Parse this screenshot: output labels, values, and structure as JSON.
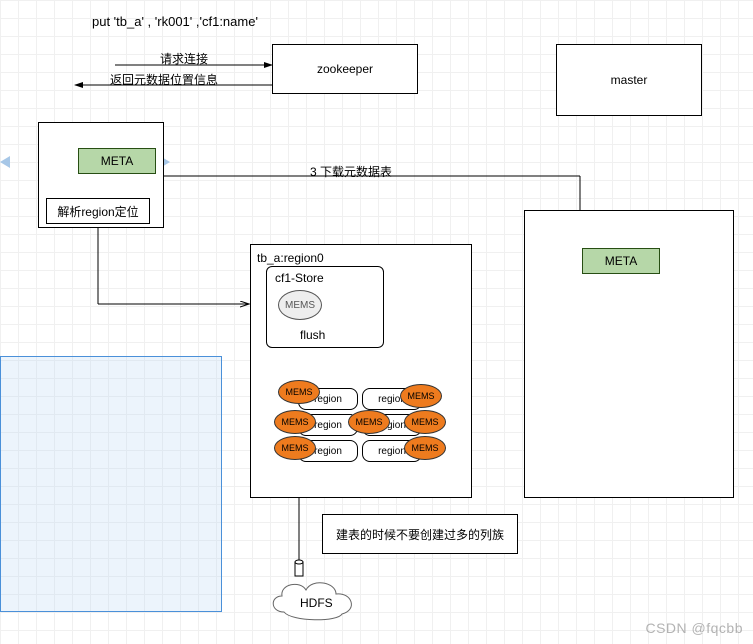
{
  "command": "put 'tb_a' , 'rk001' ,'cf1:name'",
  "arrows": {
    "request_connect": "请求连接",
    "return_meta_loc": "返回元数据位置信息",
    "download_meta": "3 下载元数据表"
  },
  "boxes": {
    "zookeeper": "zookeeper",
    "master": "master",
    "meta": "META",
    "parse_region": "解析region定位",
    "region0": "tb_a:region0",
    "cf1_store": "cf1-Store",
    "mems_circle": "MEMS",
    "flush": "flush",
    "advice": "建表的时候不要创建过多的列族",
    "hdfs": "HDFS"
  },
  "cluster": {
    "mems_label": "MEMS",
    "region_label": "region"
  },
  "watermark": "CSDN @fqcbb"
}
